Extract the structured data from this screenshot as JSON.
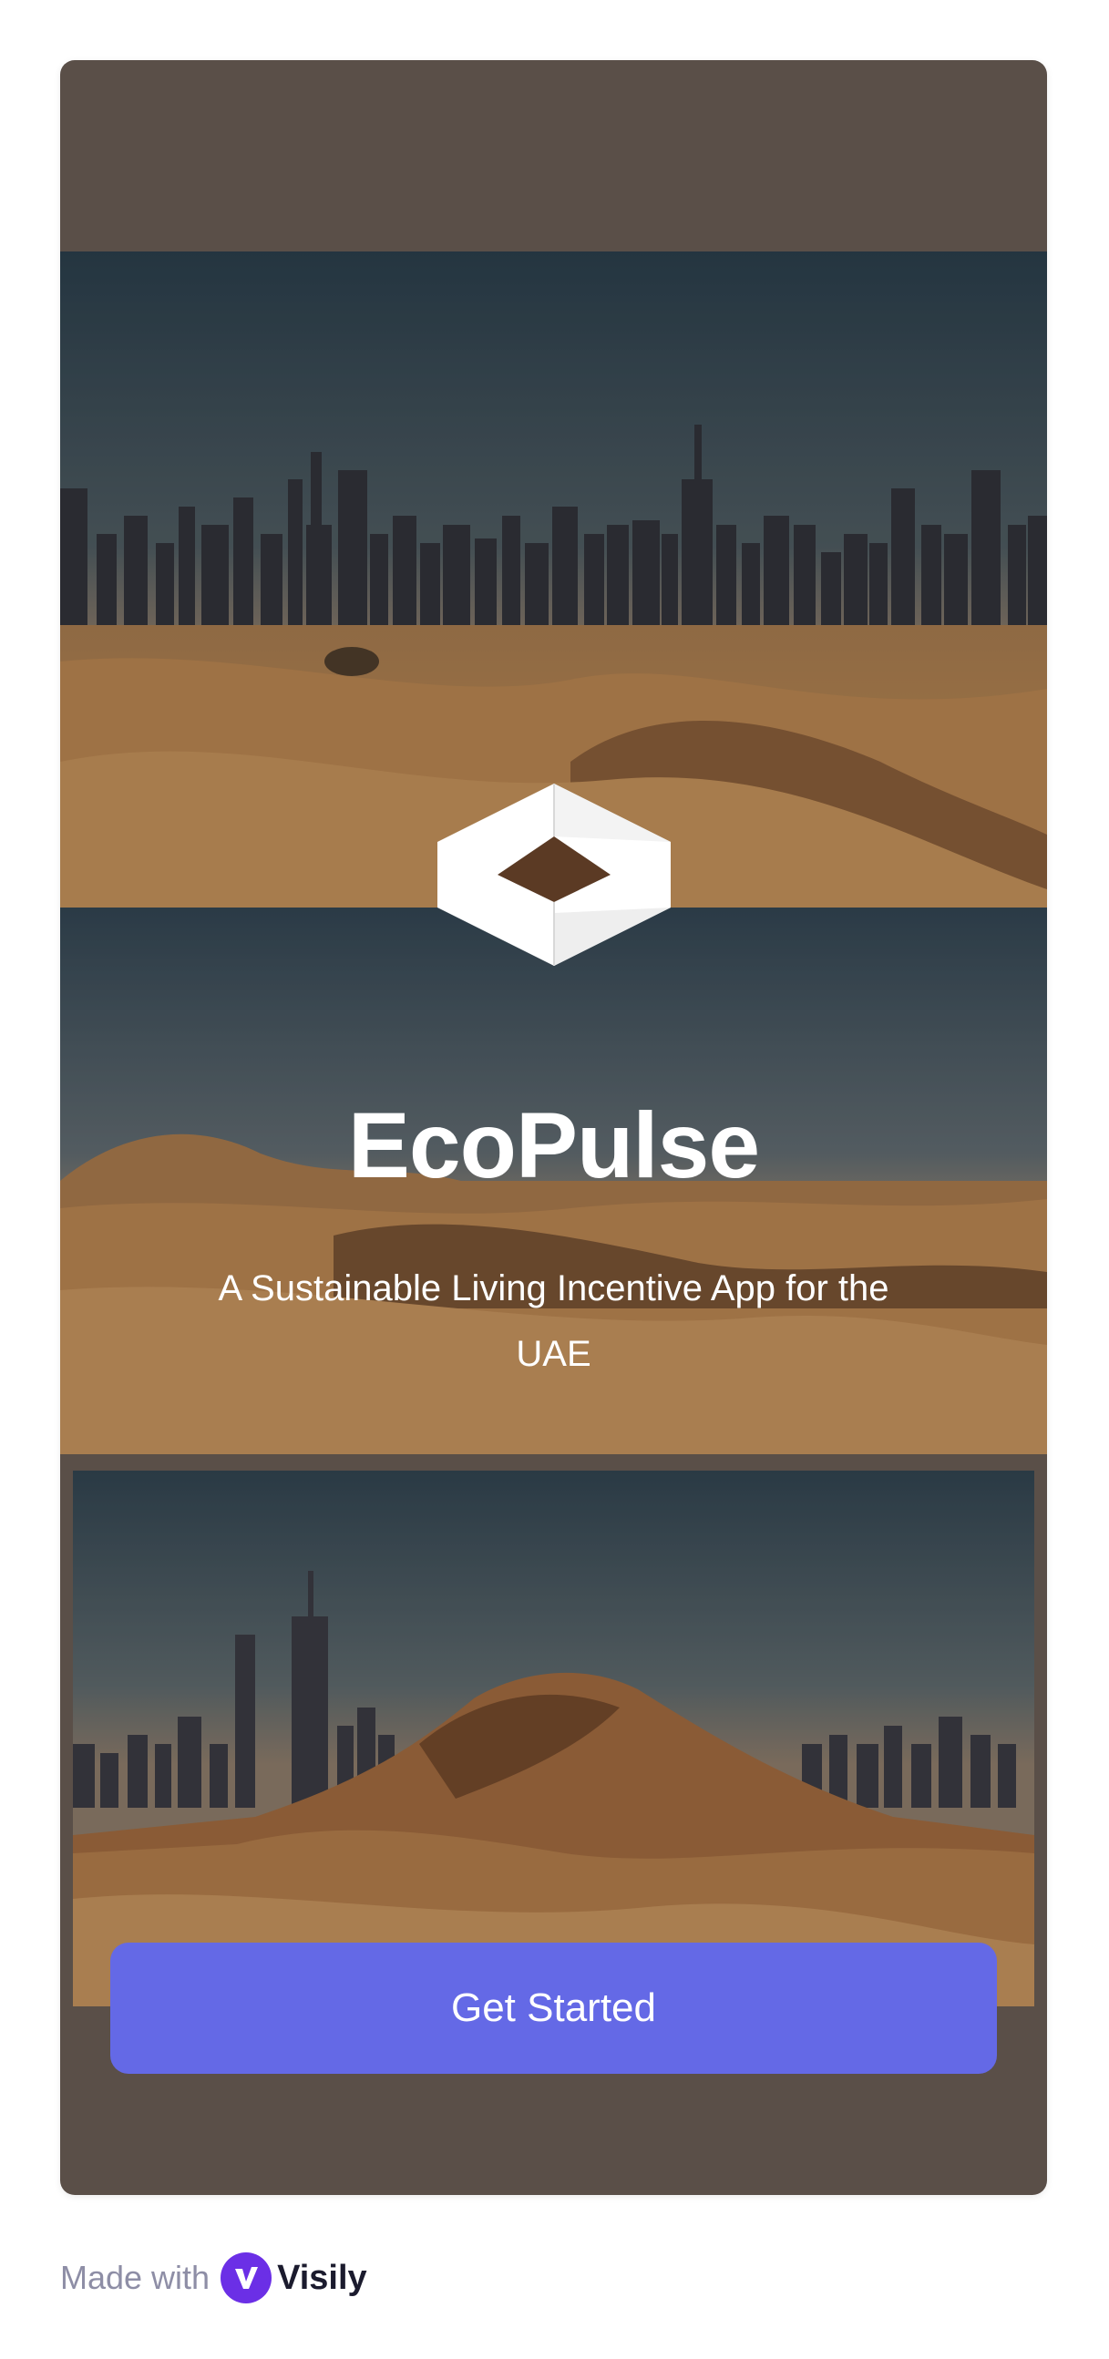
{
  "app": {
    "title": "EcoPulse",
    "subtitle": "A Sustainable Living Incentive App for the UAE"
  },
  "cta": {
    "label": "Get Started"
  },
  "footer": {
    "made_with": "Made with",
    "brand": "Visily"
  },
  "icons": {
    "logo": "hexagon-box-logo-icon",
    "brand": "visily-logo-icon"
  },
  "colors": {
    "frame": "#5a4f48",
    "accent": "#6469e6",
    "text_on_dark": "#ffffff",
    "brand_purple": "#6b2fe6",
    "footer_text": "#8e8ea6"
  }
}
